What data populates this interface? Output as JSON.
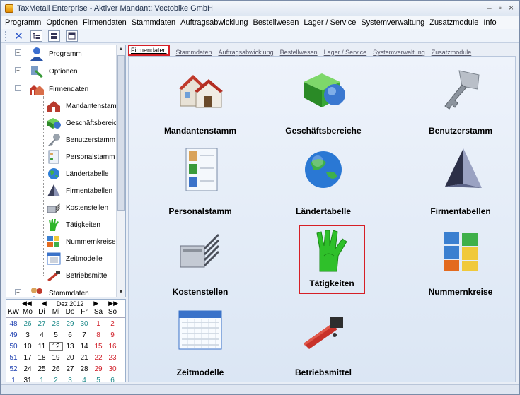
{
  "window": {
    "title": "TaxMetall Enterprise - Aktiver Mandant: Vectobike GmbH"
  },
  "window_controls": {
    "minimize": "–",
    "maximize": "▫",
    "close": "×"
  },
  "menu": [
    "Programm",
    "Optionen",
    "Firmendaten",
    "Stammdaten",
    "Auftragsabwicklung",
    "Bestellwesen",
    "Lager / Service",
    "Systemverwaltung",
    "Zusatzmodule",
    "Info"
  ],
  "tree": {
    "items": [
      {
        "label": "Programm",
        "icon": "user-icon"
      },
      {
        "label": "Optionen",
        "icon": "options-icon"
      },
      {
        "label": "Firmendaten",
        "icon": "houses-icon"
      },
      {
        "label": "Mandantenstamm",
        "icon": "house-icon"
      },
      {
        "label": "Geschäftsbereiche",
        "icon": "green-box-icon"
      },
      {
        "label": "Benutzerstamm",
        "icon": "key-icon"
      },
      {
        "label": "Personalstamm",
        "icon": "personnel-icon"
      },
      {
        "label": "Ländertabelle",
        "icon": "globe-icon"
      },
      {
        "label": "Firmentabellen",
        "icon": "pyramid-icon"
      },
      {
        "label": "Kostenstellen",
        "icon": "connector-icon"
      },
      {
        "label": "Tätigkeiten",
        "icon": "glove-icon"
      },
      {
        "label": "Nummernkreise",
        "icon": "number-blocks-icon"
      },
      {
        "label": "Zeitmodelle",
        "icon": "calendar-icon"
      },
      {
        "label": "Betriebsmittel",
        "icon": "tool-icon"
      },
      {
        "label": "Stammdaten",
        "icon": "people-icon"
      }
    ],
    "expanders": {
      "collapsed": "+",
      "expanded": "−"
    }
  },
  "scroll_arrows": {
    "up": "▲",
    "down": "▼"
  },
  "calendar": {
    "month": "Dez 2012",
    "nav": {
      "prev_year": "◀◀",
      "prev": "◀",
      "next": "▶",
      "next_year": "▶▶"
    },
    "header": [
      "KW",
      "Mo",
      "Di",
      "Mi",
      "Do",
      "Fr",
      "Sa",
      "So"
    ],
    "rows": [
      [
        "48",
        "26",
        "27",
        "28",
        "29",
        "30",
        "1",
        "2"
      ],
      [
        "49",
        "3",
        "4",
        "5",
        "6",
        "7",
        "8",
        "9"
      ],
      [
        "50",
        "10",
        "11",
        "12",
        "13",
        "14",
        "15",
        "16"
      ],
      [
        "51",
        "17",
        "18",
        "19",
        "20",
        "21",
        "22",
        "23"
      ],
      [
        "52",
        "24",
        "25",
        "26",
        "27",
        "28",
        "29",
        "30"
      ],
      [
        "1",
        "31",
        "1",
        "2",
        "3",
        "4",
        "5",
        "6"
      ]
    ]
  },
  "tabs": [
    "Firmendaten",
    "Stammdaten",
    "Auftragsabwicklung",
    "Bestellwesen",
    "Lager / Service",
    "Systemverwaltung",
    "Zusatzmodule"
  ],
  "tiles": [
    {
      "label": "Mandantenstamm",
      "icon": "house-icon"
    },
    {
      "label": "Geschäftsbereiche",
      "icon": "green-box-icon"
    },
    {
      "label": "Benutzerstamm",
      "icon": "key-icon"
    },
    {
      "label": "Personalstamm",
      "icon": "personnel-icon"
    },
    {
      "label": "Ländertabelle",
      "icon": "globe-icon"
    },
    {
      "label": "Firmentabellen",
      "icon": "pyramid-icon"
    },
    {
      "label": "Kostenstellen",
      "icon": "connector-icon"
    },
    {
      "label": "Tätigkeiten",
      "icon": "glove-icon"
    },
    {
      "label": "Nummernkreise",
      "icon": "number-blocks-icon"
    },
    {
      "label": "Zeitmodelle",
      "icon": "calendar-icon"
    },
    {
      "label": "Betriebsmittel",
      "icon": "tool-icon"
    }
  ],
  "colors": {
    "highlight": "#d61f26",
    "panel": "#e3ebf6",
    "weekend": "#d0202a",
    "week": "#1d3fb0"
  }
}
